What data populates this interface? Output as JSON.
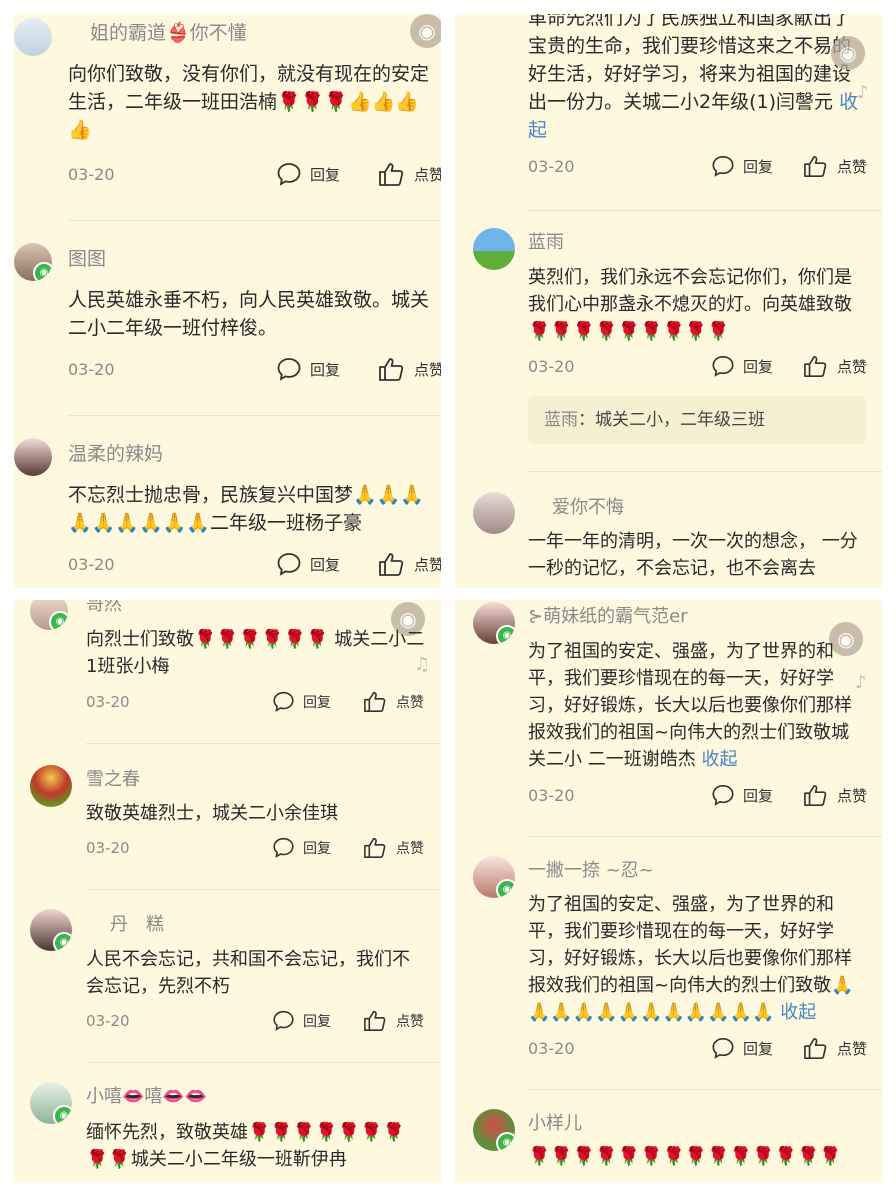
{
  "labels": {
    "reply": "回复",
    "like": "点赞",
    "fold": "收起",
    "reply_sep": "："
  },
  "colors": {
    "bg": "#fdf8de",
    "link": "#4a86c8",
    "name": "#8a8a8a",
    "wechat": "#3cb54a"
  },
  "panel1": {
    "c1": {
      "name": "姐的霸道👙你不懂",
      "text": "向你们致敬，没有你们，就没有现在的安定生活，二年级一班田浩楠🌹🌹🌹👍👍👍👍",
      "date": "03-20"
    },
    "c2": {
      "name": "图图",
      "text": "人民英雄永垂不朽，向人民英雄致敬。城关二小二年级一班付梓俊。",
      "date": "03-20"
    },
    "c3": {
      "name": "温柔的辣妈",
      "text": "不忘烈士抛忠骨，民族复兴中国梦🙏🙏🙏🙏🙏🙏🙏🙏🙏二年级一班杨子豪",
      "date": "03-20"
    }
  },
  "panel2": {
    "c1": {
      "text": "革命先烈们为了民族独立和国家献出了宝贵的生命，我们要珍惜这来之不易的好生活，好好学习，将来为祖国的建设出一份力。关城二小2年级(1)闫謦元",
      "date": "03-20"
    },
    "c2": {
      "name": "蓝雨",
      "text": "英烈们，我们永远不会忘记你们，你们是我们心中那盏永不熄灭的灯。向英雄致敬🌹🌹🌹🌹🌹🌹🌹🌹🌹",
      "date": "03-20",
      "reply_name": "蓝雨",
      "reply_text": "城关二小，二年级三班"
    },
    "c3": {
      "name": "爱你不悔",
      "text": "一年一年的清明，一次一次的想念， 一分一秒的记忆，不会忘记，也不会离去"
    }
  },
  "panel3": {
    "c1": {
      "name": "哥然",
      "text": "向烈士们致敬🌹🌹🌹🌹🌹🌹 城关二小二1班张小梅",
      "date": "03-20"
    },
    "c2": {
      "name": "雪之春",
      "text": "致敬英雄烈士，城关二小余佳琪",
      "date": "03-20"
    },
    "c3": {
      "name": "丹　糕",
      "text": "人民不会忘记，共和国不会忘记，我们不会忘记，先烈不朽",
      "date": "03-20"
    },
    "c4": {
      "name": "小嘻👄嘻👄👄",
      "text": "缅怀先烈，致敬英雄🌹🌹🌹🌹🌹🌹🌹🌹🌹城关二小二年级一班靳伊冉"
    }
  },
  "panel4": {
    "c1": {
      "name": "⊱萌妹纸的霸气范er",
      "text": "为了祖国的安定、强盛，为了世界的和平，我们要珍惜现在的每一天，好好学习，好好锻炼，长大以后也要像你们那样报效我们的祖国~向伟大的烈士们致敬城关二小 二一班谢皓杰",
      "date": "03-20"
    },
    "c2": {
      "name": "一撇一捺 ~忍~",
      "text": "为了祖国的安定、强盛，为了世界的和平，我们要珍惜现在的每一天，好好学习，好好锻炼，长大以后也要像你们那样报效我们的祖国~向伟大的烈士们致敬🙏🙏🙏🙏🙏🙏🙏🙏🙏🙏🙏🙏",
      "date": "03-20"
    },
    "c3": {
      "name": "小样儿",
      "text": "🌹🌹🌹🌹🌹🌹🌹🌹🌹🌹🌹🌹🌹🌹"
    }
  }
}
